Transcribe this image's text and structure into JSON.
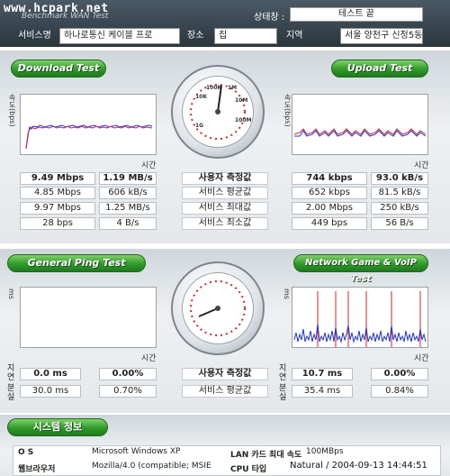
{
  "watermark": "www.hcpark.net",
  "app_subtitle": "Benchmark WAN Test",
  "status": {
    "label": "상태창 :",
    "value": "테스트 끝"
  },
  "info": {
    "service_label": "서비스명",
    "service_value": "하나로통신 케이블 프로",
    "place_label": "장소",
    "place_value": "집",
    "region_label": "지역",
    "region_value": "서울 양천구 신정5동"
  },
  "download": {
    "button": "Download Test",
    "y_label": "속도(bps)",
    "x_label": "시간",
    "rows": [
      {
        "a": "9.49 Mbps",
        "b": "1.19 MB/s"
      },
      {
        "a": "4.85 Mbps",
        "b": "606 kB/s"
      },
      {
        "a": "9.97 Mbps",
        "b": "1.25 MB/s"
      },
      {
        "a": "28 bps",
        "b": "4 B/s"
      }
    ]
  },
  "upload": {
    "button": "Upload Test",
    "y_label": "속도(bps)",
    "x_label": "시간",
    "rows": [
      {
        "a": "744 kbps",
        "b": "93.0 kB/s"
      },
      {
        "a": "652 kbps",
        "b": "81.5 kB/s"
      },
      {
        "a": "2.00 Mbps",
        "b": "250 kB/s"
      },
      {
        "a": "449 bps",
        "b": "56 B/s"
      }
    ]
  },
  "speed_center_labels": [
    "사용자 측정값",
    "서비스 평균값",
    "서비스 최대값",
    "서비스 최소값"
  ],
  "gauge1": {
    "labels": [
      "10K",
      "100K",
      "1M",
      "10M",
      "100M",
      "1G"
    ]
  },
  "ping": {
    "button": "General Ping Test",
    "y_label": "ms",
    "x_label": "시간",
    "side_label_1": "지연",
    "side_label_2": "분실",
    "row1": {
      "a": "0.0 ms",
      "b": "0.00%"
    },
    "row2": {
      "a": "30.0 ms",
      "b": "0.70%"
    }
  },
  "game": {
    "button": "Network Game & VoIP Test",
    "y_label": "ms",
    "x_label": "시간",
    "side_label_1": "지연",
    "side_label_2": "분실",
    "row1": {
      "a": "10.7 ms",
      "b": "0.00%"
    },
    "row2": {
      "a": "35.4 ms",
      "b": "0.84%"
    }
  },
  "ping_center_labels": [
    "사용자 측정값",
    "서비스 평균값"
  ],
  "system": {
    "button": "시스템 정보",
    "os_label": "O S",
    "os_value": "Microsoft Windows XP",
    "browser_label": "웹브라우저",
    "browser_value": "Mozilla/4.0 (compatible; MSIE",
    "lan_label": "LAN 카드 최대 속도",
    "lan_value": "100MBps",
    "cpu_label": "CPU 타입",
    "cpu_value": ""
  },
  "timestamp": "Natural / 2004-09-13 14:44:51"
}
